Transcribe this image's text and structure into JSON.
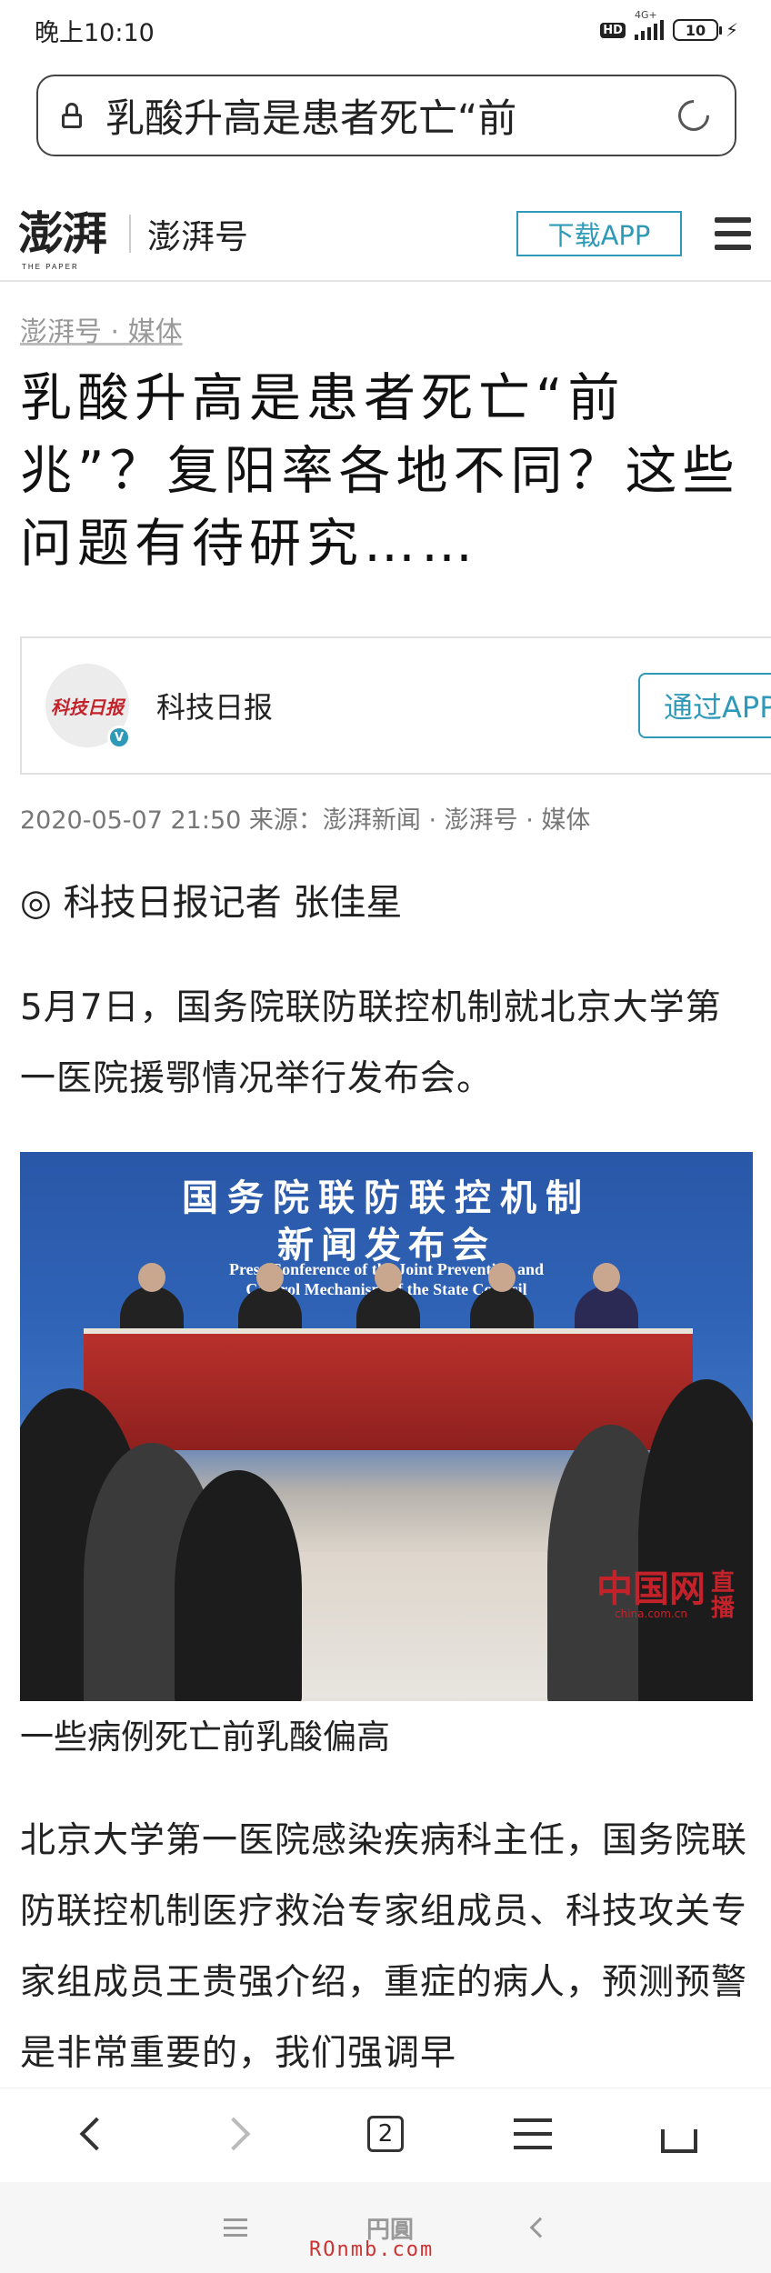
{
  "status_bar": {
    "time": "晚上10:10",
    "hd_badge": "HD",
    "network": "4G+",
    "battery": "10"
  },
  "url_bar": {
    "text": "乳酸升高是患者死亡“前"
  },
  "site_header": {
    "logo": "澎湃",
    "logo_sub": "THE PAPER",
    "channel": "澎湃号",
    "download_label": "下载APP"
  },
  "article": {
    "breadcrumb": "澎湃号 · 媒体",
    "title": "乳酸升高是患者死亡“前兆”？复阳率各地不同？这些问题有待研究……",
    "author": {
      "name": "科技日报",
      "avatar_text": "科技日报",
      "follow_label": "通过APP"
    },
    "meta": "2020-05-07 21:50 来源：澎湃新闻 · 澎湃号 · 媒体",
    "byline": "◎ 科技日报记者 张佳星",
    "paragraph_1": "5月7日，国务院联防联控机制就北京大学第一医院援鄂情况举行发布会。",
    "photo": {
      "backdrop_line1": "国务院联防联控机制",
      "backdrop_line2": "新闻发布会",
      "backdrop_en1": "Press Conference of the Joint Prevention and",
      "backdrop_en2": "Control Mechanism of the State Council",
      "watermark_logo": "中国网",
      "watermark_sub": "china.com.cn",
      "watermark_live": "直播"
    },
    "caption": "一些病例死亡前乳酸偏高",
    "paragraph_2": "北京大学第一医院感染疾病科主任，国务院联防联控机制医疗救治专家组成员、科技攻关专家组成员王贵强介绍，重症的病人，预测预警是非常重要的，我们强调早"
  },
  "bottom_nav": {
    "tabs_count": "2"
  },
  "system_nav": {
    "home_label": "円圓",
    "watermark": "ROnmb.com"
  }
}
